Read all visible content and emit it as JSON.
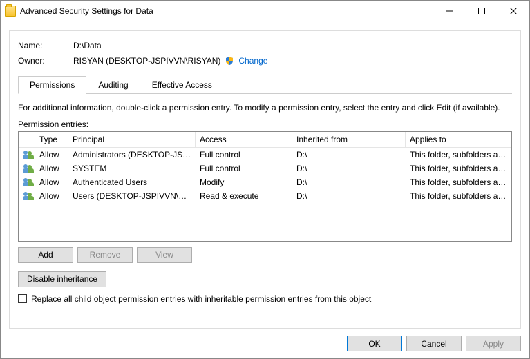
{
  "title": "Advanced Security Settings for Data",
  "name_label": "Name:",
  "name_value": "D:\\Data",
  "owner_label": "Owner:",
  "owner_value": "RISYAN (DESKTOP-JSPIVVN\\RISYAN)",
  "change_label": "Change",
  "tabs": {
    "permissions": "Permissions",
    "auditing": "Auditing",
    "effective": "Effective Access"
  },
  "description": "For additional information, double-click a permission entry. To modify a permission entry, select the entry and click Edit (if available).",
  "entries_label": "Permission entries:",
  "columns": {
    "type": "Type",
    "principal": "Principal",
    "access": "Access",
    "inherited": "Inherited from",
    "applies": "Applies to"
  },
  "entries": [
    {
      "type": "Allow",
      "principal": "Administrators (DESKTOP-JSPI...",
      "access": "Full control",
      "inherited": "D:\\",
      "applies": "This folder, subfolders and files"
    },
    {
      "type": "Allow",
      "principal": "SYSTEM",
      "access": "Full control",
      "inherited": "D:\\",
      "applies": "This folder, subfolders and files"
    },
    {
      "type": "Allow",
      "principal": "Authenticated Users",
      "access": "Modify",
      "inherited": "D:\\",
      "applies": "This folder, subfolders and files"
    },
    {
      "type": "Allow",
      "principal": "Users (DESKTOP-JSPIVVN\\Use...",
      "access": "Read & execute",
      "inherited": "D:\\",
      "applies": "This folder, subfolders and files"
    }
  ],
  "buttons": {
    "add": "Add",
    "remove": "Remove",
    "view": "View",
    "disable_inheritance": "Disable inheritance",
    "ok": "OK",
    "cancel": "Cancel",
    "apply": "Apply"
  },
  "replace_checkbox_label": "Replace all child object permission entries with inheritable permission entries from this object"
}
